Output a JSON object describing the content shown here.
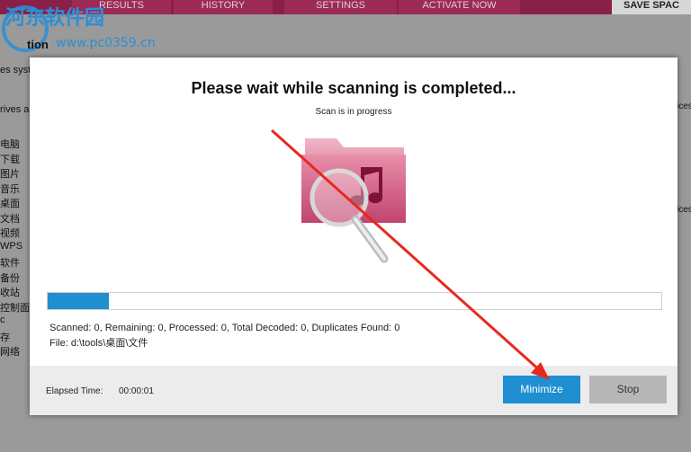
{
  "tabs": [
    "RESULTS",
    "HISTORY",
    "SETTINGS",
    "ACTIVATE NOW",
    "SAVE SPAC"
  ],
  "watermark": {
    "name": "河东软件园",
    "url": "www.pc0359.cn"
  },
  "sidebar": {
    "title": "tion",
    "line1": "es syst",
    "line2": "rives a",
    "tree": [
      "电脑",
      "下载",
      "图片",
      "音乐",
      "桌面",
      "文档",
      "视频",
      "WPS",
      "软件",
      "备份",
      "收站",
      "控制面",
      "c",
      "存",
      "网络"
    ]
  },
  "right_text": [
    "ices",
    "ices p"
  ],
  "dialog": {
    "title": "Please wait while scanning is completed...",
    "subtitle": "Scan is in progress",
    "icon": "folder-music-search-icon",
    "progress": 0.1,
    "stats": "Scanned: 0, Remaining: 0, Processed: 0, Total Decoded: 0, Duplicates Found: 0",
    "file": "File:  d:\\tools\\桌面\\文件",
    "elapsed_label": "Elapsed Time:",
    "elapsed_value": "00:00:01",
    "minimize_label": "Minimize",
    "stop_label": "Stop"
  },
  "colors": {
    "accent": "#1f8fd1",
    "topbar": "#8a1f4a",
    "arrow": "#e8281f"
  }
}
